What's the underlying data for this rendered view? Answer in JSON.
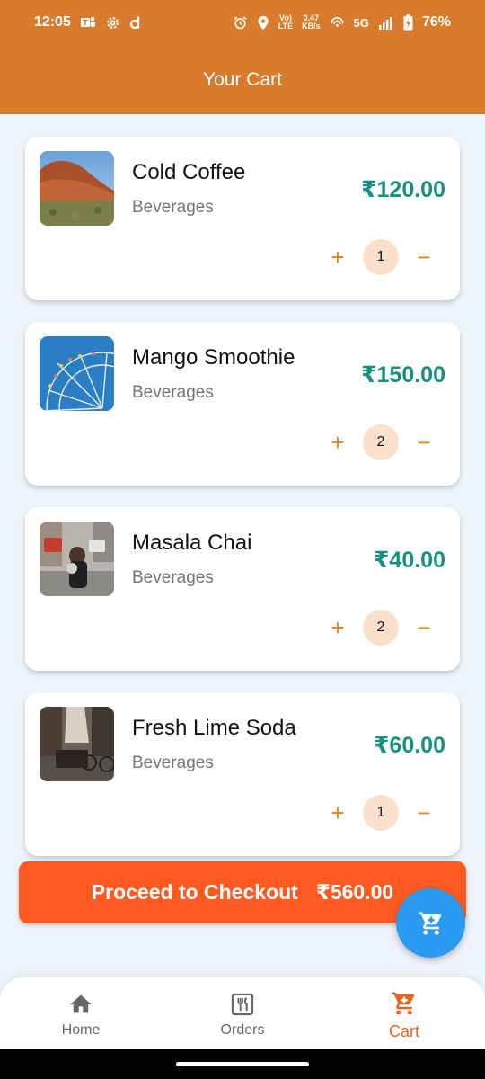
{
  "status_bar": {
    "time": "12:05",
    "network_speed_top": "0.47",
    "network_speed_bottom": "KB/s",
    "volte_top": "Vo)",
    "volte_bottom": "LTE",
    "network": "5G",
    "battery": "76%",
    "left_icons": [
      "teams-icon",
      "settings-icon",
      "d-app-icon"
    ],
    "right_icons": [
      "alarm-icon",
      "location-icon",
      "hotspot-icon",
      "signal-icon",
      "battery-icon"
    ]
  },
  "app_bar": {
    "title": "Your Cart"
  },
  "cart": {
    "items": [
      {
        "name": "Cold Coffee",
        "category": "Beverages",
        "price": "₹120.00",
        "quantity": "1",
        "plus": "+",
        "minus": "−"
      },
      {
        "name": "Mango Smoothie",
        "category": "Beverages",
        "price": "₹150.00",
        "quantity": "2",
        "plus": "+",
        "minus": "−"
      },
      {
        "name": "Masala Chai",
        "category": "Beverages",
        "price": "₹40.00",
        "quantity": "2",
        "plus": "+",
        "minus": "−"
      },
      {
        "name": "Fresh Lime Soda",
        "category": "Beverages",
        "price": "₹60.00",
        "quantity": "1",
        "plus": "+",
        "minus": "−"
      }
    ]
  },
  "checkout": {
    "label": "Proceed to Checkout",
    "total": "₹560.00"
  },
  "fab": {
    "icon": "cart-icon"
  },
  "bottom_nav": {
    "items": [
      {
        "label": "Home",
        "icon": "home-icon",
        "active": false
      },
      {
        "label": "Orders",
        "icon": "restaurant-icon",
        "active": false
      },
      {
        "label": "Cart",
        "icon": "cart-icon",
        "active": true
      }
    ]
  },
  "colors": {
    "primary": "#d97b2c",
    "price": "#18907f",
    "accent": "#e8821f",
    "checkout": "#fd5a22",
    "fab": "#2a9bf0",
    "background": "#eef4fb"
  }
}
